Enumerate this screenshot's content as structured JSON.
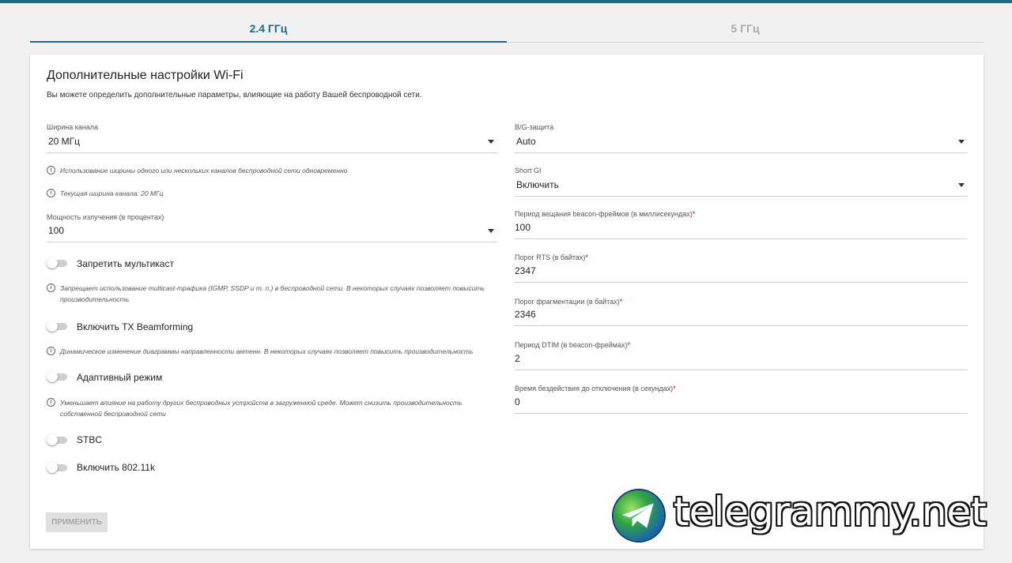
{
  "tabs": [
    {
      "label": "2.4 ГГц",
      "active": true
    },
    {
      "label": "5 ГГц",
      "active": false
    }
  ],
  "card": {
    "title": "Дополнительные настройки Wi-Fi",
    "subtitle": "Вы можете определить дополнительные параметры, влияющие на работу Вашей беспроводной сети."
  },
  "left": {
    "channel_width": {
      "label": "Ширина канала",
      "value": "20 МГц"
    },
    "hint_width_usage": "Использование ширины одного или нескольких каналов беспроводной сети одновременно",
    "hint_current_width": "Текущая ширина канала: 20 МГц",
    "tx_power": {
      "label": "Мощность излучения (в процентах)",
      "value": "100"
    },
    "toggle_multicast": {
      "label": "Запретить мультикаст",
      "on": false
    },
    "hint_multicast": "Запрещает использование multicast-трафика (IGMP, SSDP и т. п.) в беспроводной сети. В некоторых случаях позволяет повысить производительность",
    "toggle_beamforming": {
      "label": "Включить TX Beamforming",
      "on": false
    },
    "hint_beamforming": "Динамическое изменение диаграммы направленности антенн. В некоторых случаях позволяет повысить производительность",
    "toggle_adaptive": {
      "label": "Адаптивный режим",
      "on": false
    },
    "hint_adaptive": "Уменьшает влияние на работу других беспроводных устройств в загруженной среде. Может снизить производительность собственной беспроводной сети",
    "toggle_stbc": {
      "label": "STBC",
      "on": false
    },
    "toggle_80211k": {
      "label": "Включить 802.11k",
      "on": false
    }
  },
  "right": {
    "bg_protection": {
      "label": "B/G-защита",
      "value": "Auto"
    },
    "short_gi": {
      "label": "Short GI",
      "value": "Включить"
    },
    "beacon_period": {
      "label": "Период вещания beacon-фреймов (в миллисекундах)",
      "required": "*",
      "value": "100"
    },
    "rts_threshold": {
      "label": "Порог RTS (в байтах)",
      "required": "*",
      "value": "2347"
    },
    "frag_threshold": {
      "label": "Порог фрагментации (в байтах)",
      "required": "*",
      "value": "2346"
    },
    "dtim_period": {
      "label": "Период DTIM (в beacon-фреймах)",
      "required": "*",
      "value": "2"
    },
    "inactivity_timeout": {
      "label": "Время бездействия до отключения (в секундах)",
      "required": "*",
      "value": "0"
    }
  },
  "apply_label": "ПРИМЕНИТЬ",
  "watermark": {
    "text": "telegrammy.net",
    "icon": "telegram-globe-icon"
  },
  "colors": {
    "accent": "#1d6b87",
    "required": "#d0021b",
    "disabled_button": "#e0e0e0"
  }
}
